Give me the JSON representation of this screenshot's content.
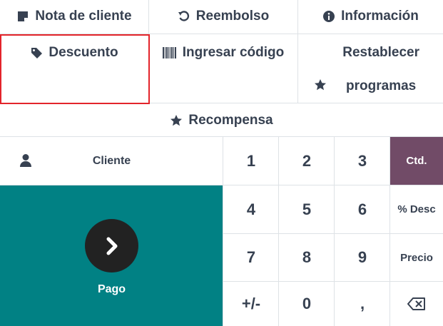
{
  "actions": {
    "customer_note": "Nota de cliente",
    "refund": "Reembolso",
    "info": "Información",
    "discount": "Descuento",
    "enter_code": "Ingresar código",
    "reset_programs": "Restablecer programas",
    "reward": "Recompensa"
  },
  "customer": {
    "label": "Cliente"
  },
  "payment": {
    "label": "Pago"
  },
  "numpad": {
    "k1": "1",
    "k2": "2",
    "k3": "3",
    "k4": "4",
    "k5": "5",
    "k6": "6",
    "k7": "7",
    "k8": "8",
    "k9": "9",
    "plusminus": "+/-",
    "k0": "0",
    "comma": ",",
    "qty": "Ctd.",
    "disc": "% Desc",
    "price": "Precio"
  },
  "colors": {
    "pay_bg": "#018184",
    "qty_active_bg": "#714b67",
    "selected_outline": "#e3242b"
  },
  "icons": {
    "customer_note": "sticky-note-icon",
    "refund": "undo-icon",
    "info": "info-circle-icon",
    "discount": "tag-icon",
    "enter_code": "barcode-icon",
    "reset_programs": "star-icon",
    "reward": "star-icon",
    "customer": "user-icon",
    "pay": "chevron-right-icon",
    "backspace": "backspace-icon"
  }
}
